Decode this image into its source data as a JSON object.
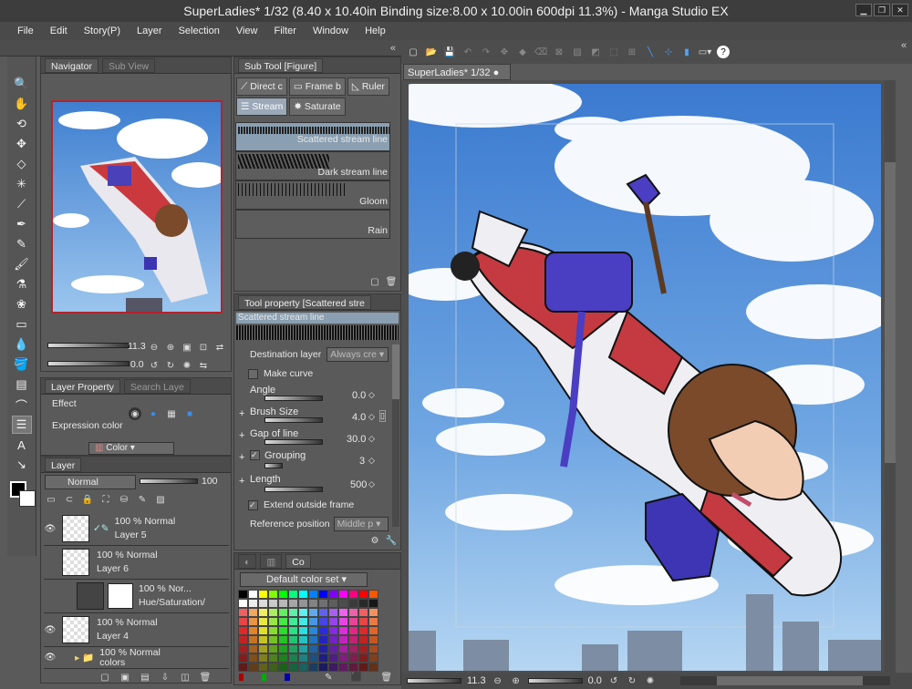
{
  "title": "SuperLadies* 1/32 (8.40 x 10.40in Binding size:8.00 x 10.00in 600dpi 11.3%)  - Manga Studio EX",
  "menu": [
    "File",
    "Edit",
    "Story(P)",
    "Layer",
    "Selection",
    "View",
    "Filter",
    "Window",
    "Help"
  ],
  "navigator": {
    "tab": "Navigator",
    "tab2": "Sub View",
    "zoom": "11.3",
    "rotation": "0.0"
  },
  "subtool": {
    "title": "Sub Tool [Figure]",
    "buttons": [
      "Direct c",
      "Frame b",
      "Ruler",
      "Stream",
      "Saturate"
    ],
    "items": [
      "Scattered stream line",
      "Dark stream line",
      "Gloom",
      "Rain"
    ]
  },
  "toolprop": {
    "title": "Tool property [Scattered stre",
    "preset": "Scattered stream line",
    "destination_label": "Destination layer",
    "destination_value": "Always cre",
    "make_curve": "Make curve",
    "angle_label": "Angle",
    "angle_value": "0.0",
    "brush_size_label": "Brush Size",
    "brush_size_value": "4.0",
    "gap_label": "Gap of line",
    "gap_value": "30.0",
    "grouping_label": "Grouping",
    "grouping_value": "3",
    "length_label": "Length",
    "length_value": "500",
    "extend_label": "Extend outside frame",
    "refpos_label": "Reference position",
    "refpos_value": "Middle p"
  },
  "layerprop": {
    "tab": "Layer Property",
    "tab2": "Search Laye",
    "effect": "Effect",
    "expression": "Expression color",
    "color": "Color"
  },
  "layers": {
    "tab": "Layer",
    "blend": "Normal",
    "opacity": "100",
    "rows": [
      {
        "pct": "100 %",
        "mode": "Normal",
        "name": "Layer 5"
      },
      {
        "pct": "100 %",
        "mode": "Normal",
        "name": "Layer 6"
      },
      {
        "pct": "100 %",
        "mode": "Nor...",
        "name": "Hue/Saturation/"
      },
      {
        "pct": "100 %",
        "mode": "Normal",
        "name": "Layer 4"
      },
      {
        "pct": "100 %",
        "mode": "Normal",
        "name": "colors"
      }
    ]
  },
  "colorset": {
    "tab": "Co",
    "set": "Default color set"
  },
  "document": {
    "tab": "SuperLadies* 1/32",
    "zoom": "11.3",
    "rotation": "0.0"
  },
  "colors": {
    "accent": "#b5232a",
    "sky": "#5e95d6",
    "panel": "#5a5a5a"
  }
}
